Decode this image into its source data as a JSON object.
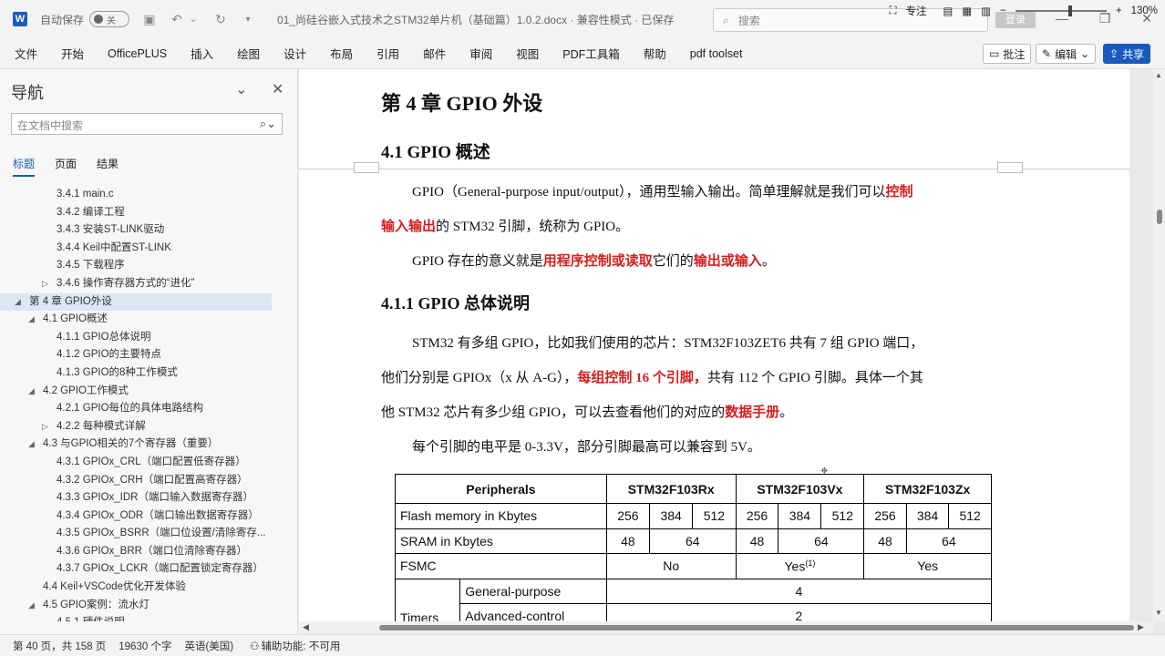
{
  "titlebar": {
    "app_icon": "W",
    "autosave_label": "自动保存",
    "autosave_state": "关",
    "doc_title": "01_尚硅谷嵌入式技术之STM32单片机（基础篇）1.0.2.docx  ·  兼容性模式 · 已保存",
    "search_placeholder": "搜索",
    "login_label": "登录"
  },
  "ribbon": {
    "tabs": [
      "文件",
      "开始",
      "OfficePLUS",
      "插入",
      "绘图",
      "设计",
      "布局",
      "引用",
      "邮件",
      "审阅",
      "视图",
      "PDF工具箱",
      "帮助",
      "pdf toolset"
    ],
    "comment_label": "批注",
    "edit_label": "编辑",
    "share_label": "共享"
  },
  "nav": {
    "title": "导航",
    "search_placeholder": "在文档中搜索",
    "tabs": [
      "标题",
      "页面",
      "结果"
    ],
    "items": [
      {
        "level": 3,
        "label": "3.4.1 main.c",
        "arrow": "",
        "selected": false
      },
      {
        "level": 3,
        "label": "3.4.2 编译工程",
        "arrow": "",
        "selected": false
      },
      {
        "level": 3,
        "label": "3.4.3 安装ST-LINK驱动",
        "arrow": "",
        "selected": false
      },
      {
        "level": 3,
        "label": "3.4.4 Keil中配置ST-LINK",
        "arrow": "",
        "selected": false
      },
      {
        "level": 3,
        "label": "3.4.5 下载程序",
        "arrow": "",
        "selected": false
      },
      {
        "level": 3,
        "label": "3.4.6 操作寄存器方式的“进化”",
        "arrow": "▷",
        "selected": false
      },
      {
        "level": 1,
        "label": "第 4 章 GPIO外设",
        "arrow": "◢",
        "selected": true
      },
      {
        "level": 2,
        "label": "4.1 GPIO概述",
        "arrow": "◢",
        "selected": false
      },
      {
        "level": 3,
        "label": "4.1.1 GPIO总体说明",
        "arrow": "",
        "selected": false
      },
      {
        "level": 3,
        "label": "4.1.2 GPIO的主要特点",
        "arrow": "",
        "selected": false
      },
      {
        "level": 3,
        "label": "4.1.3 GPIO的8种工作模式",
        "arrow": "",
        "selected": false
      },
      {
        "level": 2,
        "label": "4.2 GPIO工作模式",
        "arrow": "◢",
        "selected": false
      },
      {
        "level": 3,
        "label": "4.2.1 GPIO每位的具体电路结构",
        "arrow": "",
        "selected": false
      },
      {
        "level": 3,
        "label": "4.2.2 每种模式详解",
        "arrow": "▷",
        "selected": false
      },
      {
        "level": 2,
        "label": "4.3 与GPIO相关的7个寄存器（重要）",
        "arrow": "◢",
        "selected": false
      },
      {
        "level": 3,
        "label": "4.3.1 GPIOx_CRL（端口配置低寄存器）",
        "arrow": "",
        "selected": false
      },
      {
        "level": 3,
        "label": "4.3.2 GPIOx_CRH（端口配置高寄存器）",
        "arrow": "",
        "selected": false
      },
      {
        "level": 3,
        "label": "4.3.3 GPIOx_IDR（端口输入数据寄存器）",
        "arrow": "",
        "selected": false
      },
      {
        "level": 3,
        "label": "4.3.4 GPIOx_ODR（端口输出数据寄存器）",
        "arrow": "",
        "selected": false
      },
      {
        "level": 3,
        "label": "4.3.5 GPIOx_BSRR（端口位设置/清除寄存...",
        "arrow": "",
        "selected": false
      },
      {
        "level": 3,
        "label": "4.3.6 GPIOx_BRR（端口位清除寄存器）",
        "arrow": "",
        "selected": false
      },
      {
        "level": 3,
        "label": "4.3.7 GPIOx_LCKR（端口配置锁定寄存器）",
        "arrow": "",
        "selected": false
      },
      {
        "level": 2,
        "label": "4.4 Keil+VSCode优化开发体验",
        "arrow": "",
        "selected": false
      },
      {
        "level": 2,
        "label": "4.5 GPIO案例：流水灯",
        "arrow": "◢",
        "selected": false
      },
      {
        "level": 3,
        "label": "4.5.1 硬件说明",
        "arrow": "",
        "selected": false
      }
    ]
  },
  "document": {
    "chapter_title": "第 4 章 GPIO 外设",
    "section_title": "4.1 GPIO 概述",
    "para1": [
      "GPIO（General-purpose input/output），通用型输入输出。简单理解就是我们可以",
      "控制",
      "输入输出",
      "的 STM32 引脚，统称为 GPIO。"
    ],
    "para2": [
      "GPIO 存在的意义就是",
      "用程序控制或读取",
      "它们的",
      "输出或输入",
      "。"
    ],
    "subsection_title": "4.1.1 GPIO 总体说明",
    "para3_line1": "STM32 有多组 GPIO，比如我们使用的芯片：STM32F103ZET6 共有 7 组 GPIO 端口，",
    "para3_line2": [
      "他们分别是 GPIOx（x 从 A-G），",
      "每组控制 16 个引脚，",
      "共有 112 个 GPIO 引脚。具体一个其"
    ],
    "para3_line3": [
      "他 STM32 芯片有多少组 GPIO，可以去查看他们的对应的",
      "数据手册",
      "。"
    ],
    "para4": "每个引脚的电平是 0-3.3V，部分引脚最高可以兼容到 5V。",
    "table": {
      "headers": [
        "Peripherals",
        "STM32F103Rx",
        "STM32F103Vx",
        "STM32F103Zx"
      ],
      "flash_label": "Flash memory in Kbytes",
      "flash_values": [
        "256",
        "384",
        "512",
        "256",
        "384",
        "512",
        "256",
        "384",
        "512"
      ],
      "sram_label": "SRAM in Kbytes",
      "sram_values": [
        "48",
        "64",
        "48",
        "64",
        "48",
        "64"
      ],
      "fsmc_label": "FSMC",
      "fsmc_values": [
        "No",
        "Yes",
        "(1)",
        "Yes"
      ],
      "timers_label": "Timers",
      "timer_rows": [
        {
          "label": "General-purpose",
          "value": "4"
        },
        {
          "label": "Advanced-control",
          "value": "2"
        }
      ]
    }
  },
  "statusbar": {
    "page_info": "第 40 页，共 158 页",
    "word_count": "19630 个字",
    "language": "英语(美国)",
    "accessibility": "辅助功能: 不可用",
    "focus_label": "专注",
    "zoom_level": "130%"
  }
}
